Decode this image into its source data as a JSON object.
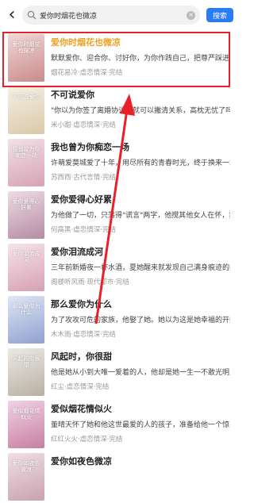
{
  "search": {
    "query": "爱你时烟花也微凉",
    "button_label": "搜索"
  },
  "books": [
    {
      "title": "爱你时烟花也微凉",
      "desc": "默默爱你、迎合你、讨好你，为你作践自己，把尊严踩进尘埃",
      "meta": "烟花易冷·虐恋情深·完结",
      "cover_text": "爱你时烟花也微凉",
      "cover_colors": [
        "#f2d6d6",
        "#c98b8b"
      ],
      "title_color": "#f0a020"
    },
    {
      "title": "不可说爱你",
      "desc": "\"你以为你签了离婚协议，就可以撇清关系，高枕无忧了吗？\"",
      "meta": "米小甜·虐恋情深·完结",
      "cover_text": "不可说爱你",
      "cover_colors": [
        "#f5f0e6",
        "#d9c9a8"
      ],
      "title_color": "#222222"
    },
    {
      "title": "我也曾为你痴恋一场",
      "desc": "许萌爱莫城爱了十年，用尽所有的青春时光，终于换来一场婚姻",
      "meta": "苏西西·古代言情·完结",
      "cover_text": "我也曾为你痴恋一场",
      "cover_colors": [
        "#f3e1e6",
        "#d6a3b4"
      ],
      "title_color": "#222222"
    },
    {
      "title": "爱你爱得心好累",
      "desc": "为他做了一切，只落得\"谎言\"两字，他搅其他女人在怀，我",
      "meta": "何高黑·虐恋情深·完结",
      "cover_text": "爱你爱得心好累",
      "cover_colors": [
        "#eedbe4",
        "#b58ca3"
      ],
      "title_color": "#222222"
    },
    {
      "title": "爱你泪流成河",
      "desc": "三年前新婚夜一杯水酒，夏她醒来就发现自己满身痕迹的躺在",
      "meta": "阁楼听风雨·现代都市·完结",
      "cover_text": "爱你泪流成河",
      "cover_colors": [
        "#f6e4ea",
        "#d7a0b2"
      ],
      "title_color": "#222222"
    },
    {
      "title": "那么爱你为什么",
      "desc": "为了攻攻可危的家族，他娶了她。她以为这是她幸福的开始",
      "meta": "木木雨·虐恋情深·完结",
      "cover_text": "那么爱你为什么",
      "cover_colors": [
        "#dfe6f5",
        "#8fa1cf"
      ],
      "title_color": "#222222"
    },
    {
      "title": "风起时，你很甜",
      "desc": "他是她从小到大唯一爱着的人，他却是她一生一不敢光明正大",
      "meta": "红尘·虐恋情深·完结",
      "cover_text": "风起时你很甜",
      "cover_colors": [
        "#ece9e4",
        "#b9b0a4"
      ],
      "title_color": "#222222"
    },
    {
      "title": "爱似烟花情似火",
      "desc": "董晴天怀了她和他这世最爱的人的孩子，准备给他一个惊喜。",
      "meta": "红红火火·虐恋情深·完结",
      "cover_text": "爱似烟花情似火",
      "cover_colors": [
        "#f1d3e2",
        "#c77ea3"
      ],
      "title_color": "#222222"
    },
    {
      "title": "爱你如夜色微凉",
      "desc": "",
      "meta": "",
      "cover_text": "爱你如夜色微凉",
      "cover_colors": [
        "#f0dfe4",
        "#c9a2ae"
      ],
      "title_color": "#222222"
    }
  ],
  "annotation_color": "#e8202a"
}
